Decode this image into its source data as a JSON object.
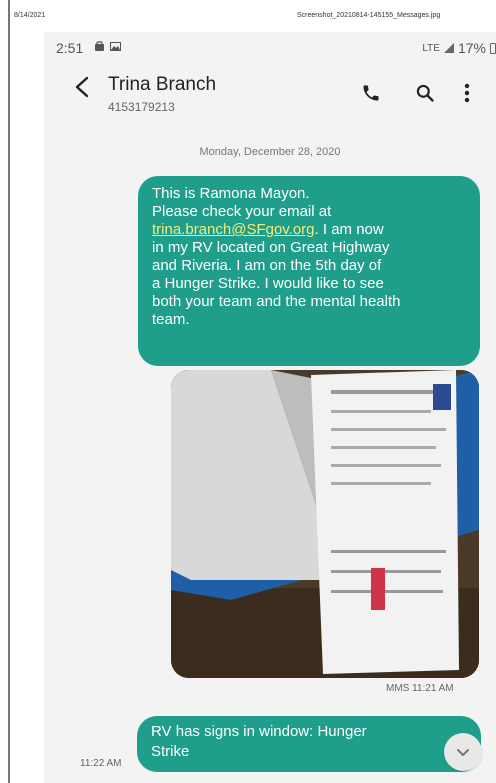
{
  "document": {
    "date": "8/14/2021",
    "filename": "Screenshot_20210814-145155_Messages.jpg"
  },
  "status_bar": {
    "time": "2:51",
    "notification_icons": [
      "bag-icon",
      "image-icon"
    ],
    "network": "LTE",
    "battery": "17%"
  },
  "header": {
    "contact_name": "Trina Branch",
    "contact_number": "4153179213",
    "icons": [
      "back-arrow-icon",
      "phone-icon",
      "search-icon",
      "more-vertical-icon"
    ]
  },
  "conversation": {
    "date_separator": "Monday, December 28, 2020",
    "message_1": {
      "line_1": "This is Ramona Mayon.",
      "line_2": "Please check your email at",
      "email": "trina.branch@SFgov.org",
      "line_3_rest": ". I am now",
      "line_4": "in my RV located on Great Highway",
      "line_5": "and Riveria.  I am on the 5th day of",
      "line_6": "a Hunger Strike.   I would like to see",
      "line_7": "both your team and the mental health",
      "line_8": "team."
    },
    "mms": {
      "meta": "MMS 11:21 AM"
    },
    "message_2": {
      "line_1": "RV has signs in window: Hunger",
      "line_2": "Strike",
      "time": "11:22 AM"
    }
  },
  "colors": {
    "bubble": "#1f9e8c",
    "link": "#f1ee7a",
    "background": "#f3f3f3"
  }
}
